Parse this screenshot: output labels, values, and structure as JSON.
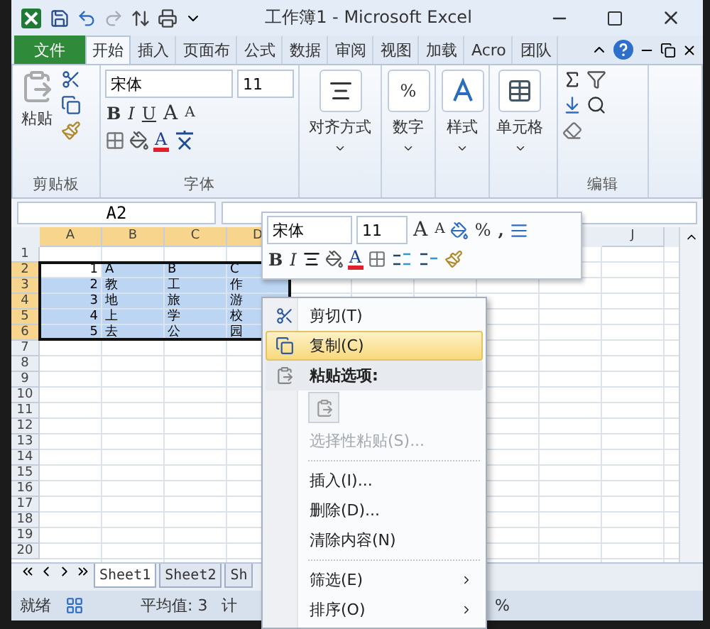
{
  "window": {
    "title": "工作簿1 - Microsoft Excel"
  },
  "ribbon_tabs": [
    {
      "label": "文件",
      "kind": "file",
      "selected": false
    },
    {
      "label": "开始",
      "kind": "tab",
      "selected": true
    },
    {
      "label": "插入",
      "kind": "tab",
      "selected": false
    },
    {
      "label": "页面布",
      "kind": "tab",
      "selected": false
    },
    {
      "label": "公式",
      "kind": "tab",
      "selected": false
    },
    {
      "label": "数据",
      "kind": "tab",
      "selected": false
    },
    {
      "label": "审阅",
      "kind": "tab",
      "selected": false
    },
    {
      "label": "视图",
      "kind": "tab",
      "selected": false
    },
    {
      "label": "加载",
      "kind": "tab",
      "selected": false
    },
    {
      "label": "Acro",
      "kind": "tab",
      "selected": false
    },
    {
      "label": "团队",
      "kind": "tab",
      "selected": false
    }
  ],
  "ribbon": {
    "clipboard": {
      "paste": "粘贴",
      "title": "剪贴板"
    },
    "font": {
      "name": "宋体",
      "size": "11",
      "bold": "B",
      "italic": "I",
      "underline": "U",
      "grow": "A",
      "shrink": "A",
      "color_letter": "A",
      "title": "字体"
    },
    "groups": [
      {
        "label": "对齐方式",
        "kind": "align"
      },
      {
        "label": "数字",
        "kind": "number",
        "glyph": "%"
      },
      {
        "label": "样式",
        "kind": "style"
      },
      {
        "label": "单元格",
        "kind": "cells"
      }
    ],
    "editing": {
      "title": "编辑"
    }
  },
  "name_box": "A2",
  "columns": [
    {
      "label": "A",
      "selected": true
    },
    {
      "label": "B",
      "selected": true
    },
    {
      "label": "C",
      "selected": true
    },
    {
      "label": "D",
      "selected": true
    },
    {
      "label": "J",
      "selected": false
    }
  ],
  "rows": [
    {
      "label": "1",
      "selected": false
    },
    {
      "label": "2",
      "selected": true,
      "cells": [
        "1",
        "A",
        "B",
        "C"
      ]
    },
    {
      "label": "3",
      "selected": true,
      "cells": [
        "2",
        "教",
        "工",
        "作"
      ]
    },
    {
      "label": "4",
      "selected": true,
      "cells": [
        "3",
        "地",
        "旅",
        "游"
      ]
    },
    {
      "label": "5",
      "selected": true,
      "cells": [
        "4",
        "上",
        "学",
        "校"
      ]
    },
    {
      "label": "6",
      "selected": true,
      "cells": [
        "5",
        "去",
        "公",
        "园"
      ]
    },
    {
      "label": "7",
      "selected": false
    },
    {
      "label": "8",
      "selected": false
    },
    {
      "label": "9",
      "selected": false
    },
    {
      "label": "10",
      "selected": false
    },
    {
      "label": "11",
      "selected": false
    },
    {
      "label": "12",
      "selected": false
    },
    {
      "label": "13",
      "selected": false
    },
    {
      "label": "14",
      "selected": false
    },
    {
      "label": "15",
      "selected": false
    },
    {
      "label": "16",
      "selected": false
    },
    {
      "label": "17",
      "selected": false
    },
    {
      "label": "18",
      "selected": false
    },
    {
      "label": "19",
      "selected": false
    },
    {
      "label": "20",
      "selected": false
    }
  ],
  "mini_toolbar": {
    "font": "宋体",
    "size": "11",
    "grow": "A",
    "shrink": "A",
    "percent": "%",
    "comma": ",",
    "bold": "B",
    "italic": "I",
    "color_letter": "A"
  },
  "context_menu": [
    {
      "kind": "cut",
      "label": "剪切(T)",
      "selected": false,
      "disabled": false
    },
    {
      "kind": "copy",
      "label": "复制(C)",
      "selected": true,
      "disabled": false
    },
    {
      "kind": "header",
      "label": "粘贴选项:"
    },
    {
      "kind": "paste"
    },
    {
      "kind": "item",
      "label": "选择性粘贴(S)...",
      "selected": false,
      "disabled": true
    },
    {
      "kind": "separator"
    },
    {
      "kind": "item",
      "label": "插入(I)...",
      "selected": false,
      "disabled": false
    },
    {
      "kind": "item",
      "label": "删除(D)...",
      "selected": false,
      "disabled": false
    },
    {
      "kind": "item",
      "label": "清除内容(N)",
      "selected": false,
      "disabled": false
    },
    {
      "kind": "separator"
    },
    {
      "kind": "submenu",
      "label": "筛选(E)",
      "selected": false,
      "disabled": false
    },
    {
      "kind": "submenu",
      "label": "排序(O)",
      "selected": false,
      "disabled": false
    }
  ],
  "sheet_tabs": [
    {
      "label": "Sheet1",
      "selected": true
    },
    {
      "label": "Sheet2",
      "selected": false
    },
    {
      "label": "Sh",
      "selected": false
    }
  ],
  "status_bar": {
    "mode": "就绪",
    "average": "平均值: 3",
    "count": "计",
    "zoom": "%"
  }
}
